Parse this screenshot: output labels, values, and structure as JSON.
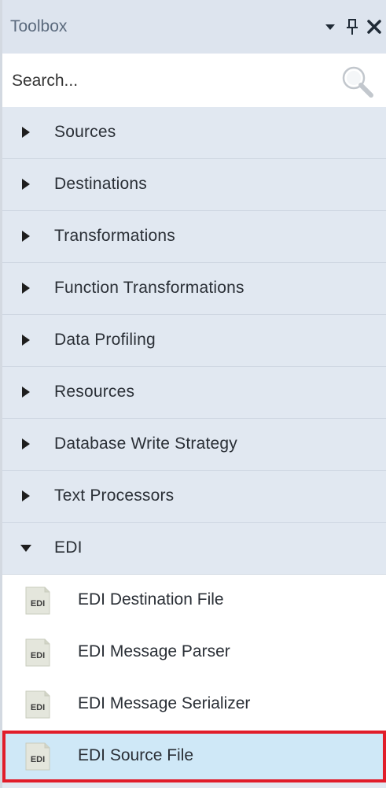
{
  "header": {
    "title": "Toolbox",
    "icons": [
      "dropdown-arrow-icon",
      "pin-icon",
      "close-icon"
    ]
  },
  "search": {
    "placeholder": "Search..."
  },
  "categories": [
    {
      "label": "Sources",
      "expanded": false
    },
    {
      "label": "Destinations",
      "expanded": false
    },
    {
      "label": "Transformations",
      "expanded": false
    },
    {
      "label": "Function Transformations",
      "expanded": false
    },
    {
      "label": "Data Profiling",
      "expanded": false
    },
    {
      "label": "Resources",
      "expanded": false
    },
    {
      "label": "Database Write Strategy",
      "expanded": false
    },
    {
      "label": "Text Processors",
      "expanded": false
    },
    {
      "label": "EDI",
      "expanded": true
    }
  ],
  "edi_items": [
    {
      "label": "EDI Destination File",
      "icon_text": "EDI",
      "selected": false
    },
    {
      "label": "EDI Message Parser",
      "icon_text": "EDI",
      "selected": false
    },
    {
      "label": "EDI Message Serializer",
      "icon_text": "EDI",
      "selected": false
    },
    {
      "label": "EDI Source File",
      "icon_text": "EDI",
      "selected": true
    }
  ],
  "colors": {
    "highlight_border": "#e11d2a",
    "selected_bg": "#cfe8f7",
    "category_bg": "#e1e8f1"
  }
}
